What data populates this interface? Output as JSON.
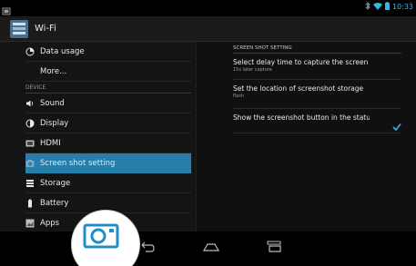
{
  "status_bar": {
    "time": "10:33",
    "icons": [
      "notification-icon",
      "bluetooth-icon",
      "wifi-icon",
      "battery-icon"
    ]
  },
  "action_bar": {
    "title": "Wi-Fi",
    "icon": "settings-app-icon"
  },
  "left_pane": {
    "items": [
      {
        "label": "Data usage",
        "icon": "data-usage-icon"
      },
      {
        "label": "More...",
        "icon": ""
      }
    ],
    "section_device": "DEVICE",
    "device_items": [
      {
        "label": "Sound",
        "icon": "speaker-icon"
      },
      {
        "label": "Display",
        "icon": "brightness-icon"
      },
      {
        "label": "HDMI",
        "icon": "hdmi-icon"
      },
      {
        "label": "Screen shot setting",
        "icon": "screenshot-icon",
        "selected": true
      },
      {
        "label": "Storage",
        "icon": "storage-icon"
      },
      {
        "label": "Battery",
        "icon": "battery-icon"
      },
      {
        "label": "Apps",
        "icon": "apps-icon"
      }
    ]
  },
  "right_pane": {
    "header": "SCREEN SHOT SETTING",
    "prefs": [
      {
        "title": "Select delay time to capture the screen",
        "summary": "15s later capture"
      },
      {
        "title": "Set the location of screenshot storage",
        "summary": "flash"
      },
      {
        "title": "Show the screenshot button in the statusb",
        "summary": "",
        "checked": true
      }
    ]
  },
  "nav_bar": {
    "buttons": [
      "back-icon",
      "home-icon",
      "recents-icon"
    ]
  },
  "colors": {
    "accent": "#33b5e5",
    "selected_row": "#267faa",
    "background": "#101010"
  }
}
